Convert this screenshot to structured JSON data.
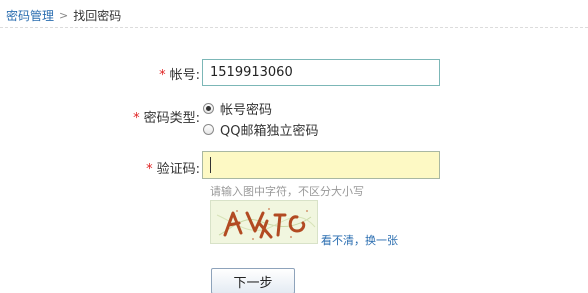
{
  "breadcrumb": {
    "parent": "密码管理",
    "separator": ">",
    "current": "找回密码"
  },
  "form": {
    "required_mark": "*",
    "account": {
      "label": "帐号:",
      "value": "1519913060"
    },
    "password_type": {
      "label": "密码类型:",
      "options": [
        {
          "label": "帐号密码",
          "selected": true
        },
        {
          "label": "QQ邮箱独立密码",
          "selected": false
        }
      ]
    },
    "captcha": {
      "label": "验证码:",
      "value": "",
      "hint": "请输入图中字符，不区分大小写",
      "refresh_link": "看不清，换一张"
    },
    "next_button": "下一步"
  },
  "colors": {
    "link": "#2a6db0",
    "required": "#e02020",
    "active_input_bg": "#fdf9c4"
  }
}
